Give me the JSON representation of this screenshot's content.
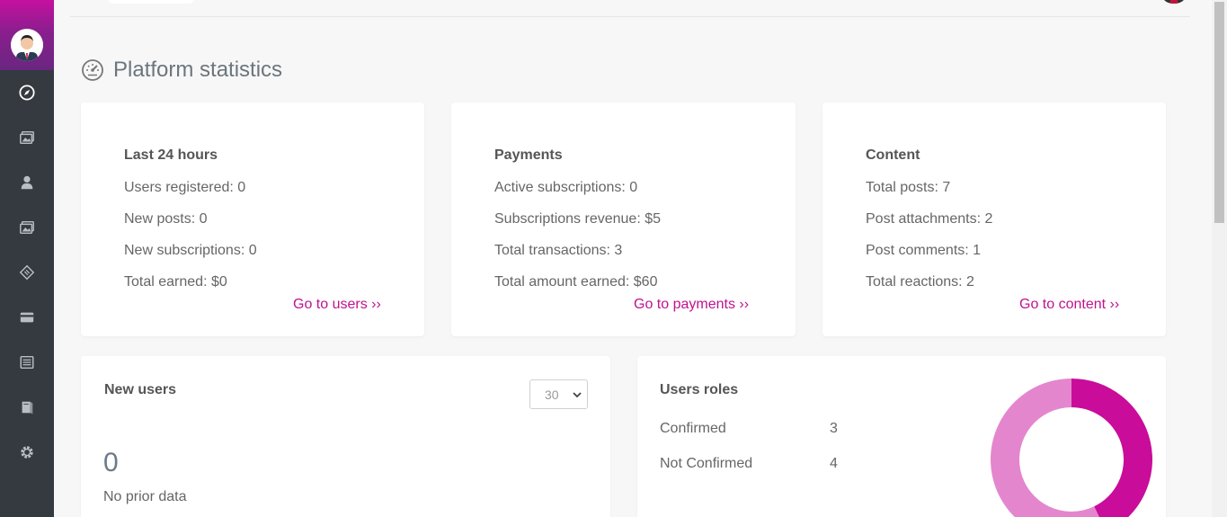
{
  "sidebar": {
    "items": [
      {
        "icon": "compass-icon"
      },
      {
        "icon": "images-icon"
      },
      {
        "icon": "user-icon"
      },
      {
        "icon": "image-icon"
      },
      {
        "icon": "ticket-icon"
      },
      {
        "icon": "credit-card-icon"
      },
      {
        "icon": "newspaper-icon"
      },
      {
        "icon": "book-icon"
      },
      {
        "icon": "settings-icon"
      }
    ]
  },
  "page": {
    "title": "Platform statistics"
  },
  "cards": {
    "last24": {
      "title": "Last 24 hours",
      "lines": [
        "Users registered: 0",
        "New posts: 0",
        "New subscriptions: 0",
        "Total earned: $0"
      ],
      "link": "Go to users ››"
    },
    "payments": {
      "title": "Payments",
      "lines": [
        "Active subscriptions: 0",
        "Subscriptions revenue: $5",
        "Total transactions: 3",
        "Total amount earned: $60"
      ],
      "link": "Go to payments ››"
    },
    "content": {
      "title": "Content",
      "lines": [
        "Total posts: 7",
        "Post attachments: 2",
        "Post comments: 1",
        "Total reactions: 2"
      ],
      "link": "Go to content ››"
    }
  },
  "new_users": {
    "title": "New users",
    "select_value": "30",
    "count": "0",
    "note": "No prior data"
  },
  "roles": {
    "title": "Users roles",
    "rows": [
      {
        "label": "Confirmed",
        "value": "3"
      },
      {
        "label": "Not Confirmed",
        "value": "4"
      }
    ]
  },
  "colors": {
    "accent": "#c1128f",
    "donut_confirmed": "#c90c9a",
    "donut_not_confirmed": "#e486ce"
  }
}
